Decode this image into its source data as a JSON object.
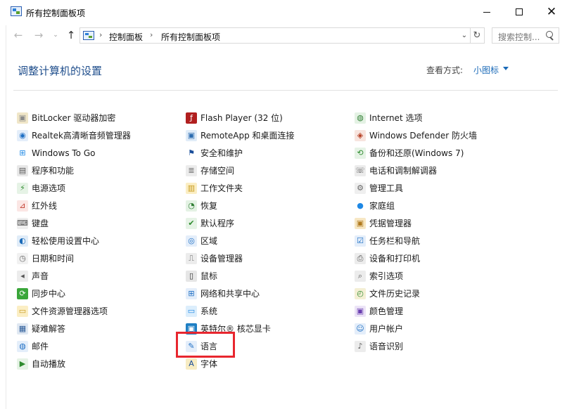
{
  "window": {
    "title": "所有控制面板项",
    "minimize_glyph": "",
    "maximize_glyph": "",
    "close_glyph": "✕"
  },
  "nav": {
    "back_glyph": "←",
    "forward_glyph": "→",
    "recent_glyph": "⌄",
    "up_glyph": "↑",
    "breadcrumb": [
      "控制面板",
      "所有控制面板项"
    ],
    "separator": "›",
    "dropdown_glyph": "⌄",
    "refresh_glyph": "↻",
    "search_placeholder": "搜索控制..."
  },
  "content": {
    "heading": "调整计算机的设置",
    "view_by_label": "查看方式:",
    "view_by_value": "小图标"
  },
  "columns": [
    [
      {
        "label": "BitLocker 驱动器加密",
        "icon": "bitlocker-icon",
        "glyph": "▣",
        "color": "#8a8a8a",
        "bg": "#f0e6c8"
      },
      {
        "label": "Realtek高清晰音频管理器",
        "icon": "realtek-audio-icon",
        "glyph": "◉",
        "color": "#1e6fc4",
        "bg": "#e4eefa"
      },
      {
        "label": "Windows To Go",
        "icon": "windows-to-go-icon",
        "glyph": "⊞",
        "color": "#1e88e5",
        "bg": "#ffffff"
      },
      {
        "label": "程序和功能",
        "icon": "programs-features-icon",
        "glyph": "▤",
        "color": "#555555",
        "bg": "#e8e8e8"
      },
      {
        "label": "电源选项",
        "icon": "power-options-icon",
        "glyph": "⚡",
        "color": "#2e8b2e",
        "bg": "#e6f3e6"
      },
      {
        "label": "红外线",
        "icon": "infrared-icon",
        "glyph": "⊿",
        "color": "#c0392b",
        "bg": "#fbe6e4"
      },
      {
        "label": "键盘",
        "icon": "keyboard-icon",
        "glyph": "⌨",
        "color": "#555555",
        "bg": "#eeeeee"
      },
      {
        "label": "轻松使用设置中心",
        "icon": "ease-of-access-icon",
        "glyph": "◐",
        "color": "#1a6ab8",
        "bg": "#e0ecf8"
      },
      {
        "label": "日期和时间",
        "icon": "date-time-icon",
        "glyph": "◷",
        "color": "#666666",
        "bg": "#f1f1f1"
      },
      {
        "label": "声音",
        "icon": "sound-icon",
        "glyph": "◂",
        "color": "#555555",
        "bg": "#ececec"
      },
      {
        "label": "同步中心",
        "icon": "sync-center-icon",
        "glyph": "⟳",
        "color": "#ffffff",
        "bg": "#3aa63a"
      },
      {
        "label": "文件资源管理器选项",
        "icon": "file-explorer-options-icon",
        "glyph": "▭",
        "color": "#c79a1e",
        "bg": "#fbeec4"
      },
      {
        "label": "疑难解答",
        "icon": "troubleshooting-icon",
        "glyph": "▦",
        "color": "#2c5c99",
        "bg": "#e0e8f2"
      },
      {
        "label": "邮件",
        "icon": "mail-icon",
        "glyph": "◍",
        "color": "#1e6fc4",
        "bg": "#e4eefa"
      },
      {
        "label": "自动播放",
        "icon": "autoplay-icon",
        "glyph": "▶",
        "color": "#2e8b2e",
        "bg": "#e6f3e6"
      }
    ],
    [
      {
        "label": "Flash Player (32 位)",
        "icon": "flash-player-icon",
        "glyph": "ƒ",
        "color": "#ffffff",
        "bg": "#b11f1f"
      },
      {
        "label": "RemoteApp 和桌面连接",
        "icon": "remoteapp-icon",
        "glyph": "▣",
        "color": "#2b6cb0",
        "bg": "#e0ecf8"
      },
      {
        "label": "安全和维护",
        "icon": "security-maintenance-icon",
        "glyph": "⚑",
        "color": "#1a4e9a",
        "bg": "#ffffff"
      },
      {
        "label": "存储空间",
        "icon": "storage-spaces-icon",
        "glyph": "≣",
        "color": "#666666",
        "bg": "#ececec"
      },
      {
        "label": "工作文件夹",
        "icon": "work-folders-icon",
        "glyph": "▥",
        "color": "#c79a1e",
        "bg": "#fbeec4"
      },
      {
        "label": "恢复",
        "icon": "recovery-icon",
        "glyph": "◔",
        "color": "#2e7d32",
        "bg": "#e4f2e4"
      },
      {
        "label": "默认程序",
        "icon": "default-programs-icon",
        "glyph": "✔",
        "color": "#2e8b2e",
        "bg": "#e6f3e6"
      },
      {
        "label": "区域",
        "icon": "region-icon",
        "glyph": "◎",
        "color": "#1e6fc4",
        "bg": "#e4eefa"
      },
      {
        "label": "设备管理器",
        "icon": "device-manager-icon",
        "glyph": "⎍",
        "color": "#555555",
        "bg": "#ececec"
      },
      {
        "label": "鼠标",
        "icon": "mouse-icon",
        "glyph": "▯",
        "color": "#333333",
        "bg": "#e6e6e6"
      },
      {
        "label": "网络和共享中心",
        "icon": "network-sharing-icon",
        "glyph": "⊞",
        "color": "#1e6fc4",
        "bg": "#e4eefa"
      },
      {
        "label": "系统",
        "icon": "system-icon",
        "glyph": "▭",
        "color": "#1e88e5",
        "bg": "#dceefc"
      },
      {
        "label": "英特尔® 核芯显卡",
        "icon": "intel-graphics-icon",
        "glyph": "▣",
        "color": "#ffffff",
        "bg": "#1e7fc4"
      },
      {
        "label": "语言",
        "icon": "language-icon",
        "glyph": "✎",
        "color": "#1e6fc4",
        "bg": "#e4eefa"
      },
      {
        "label": "字体",
        "icon": "fonts-icon",
        "glyph": "A",
        "color": "#1a4e9a",
        "bg": "#f7ecc3"
      }
    ],
    [
      {
        "label": "Internet 选项",
        "icon": "internet-options-icon",
        "glyph": "◍",
        "color": "#2e7d32",
        "bg": "#e4f2e4"
      },
      {
        "label": "Windows Defender 防火墙",
        "icon": "windows-defender-firewall-icon",
        "glyph": "◈",
        "color": "#b33a1e",
        "bg": "#f7e4de"
      },
      {
        "label": "备份和还原(Windows 7)",
        "icon": "backup-restore-icon",
        "glyph": "⟲",
        "color": "#2e8b2e",
        "bg": "#e6f3e6"
      },
      {
        "label": "电话和调制解调器",
        "icon": "phone-modem-icon",
        "glyph": "☏",
        "color": "#555555",
        "bg": "#ececec"
      },
      {
        "label": "管理工具",
        "icon": "administrative-tools-icon",
        "glyph": "⚙",
        "color": "#666666",
        "bg": "#efefef"
      },
      {
        "label": "家庭组",
        "icon": "homegroup-icon",
        "glyph": "●",
        "color": "#1e88e5",
        "bg": "#ffffff"
      },
      {
        "label": "凭据管理器",
        "icon": "credential-manager-icon",
        "glyph": "▣",
        "color": "#b07a1e",
        "bg": "#f7e7c4"
      },
      {
        "label": "任务栏和导航",
        "icon": "taskbar-navigation-icon",
        "glyph": "☑",
        "color": "#1e6fc4",
        "bg": "#e4eefa"
      },
      {
        "label": "设备和打印机",
        "icon": "devices-printers-icon",
        "glyph": "⎙",
        "color": "#555555",
        "bg": "#ececec"
      },
      {
        "label": "索引选项",
        "icon": "indexing-options-icon",
        "glyph": "⌕",
        "color": "#555555",
        "bg": "#ececec"
      },
      {
        "label": "文件历史记录",
        "icon": "file-history-icon",
        "glyph": "◴",
        "color": "#2e8b2e",
        "bg": "#f4efd4"
      },
      {
        "label": "颜色管理",
        "icon": "color-management-icon",
        "glyph": "▣",
        "color": "#6a3fb0",
        "bg": "#ece4f7"
      },
      {
        "label": "用户帐户",
        "icon": "user-accounts-icon",
        "glyph": "☺",
        "color": "#1e6fc4",
        "bg": "#e4eefa"
      },
      {
        "label": "语音识别",
        "icon": "speech-recognition-icon",
        "glyph": "♪",
        "color": "#555555",
        "bg": "#ececec"
      }
    ]
  ],
  "annotation": {
    "highlight_color": "#e8262e",
    "highlighted_item": "语言"
  }
}
